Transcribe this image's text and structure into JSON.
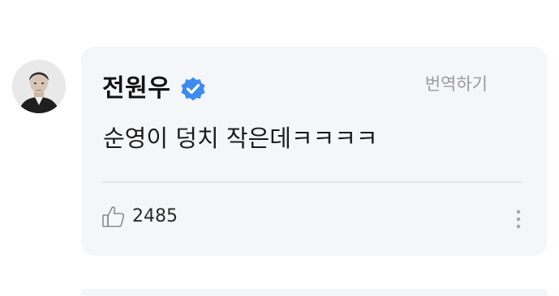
{
  "comment": {
    "author": "전원우",
    "verified": true,
    "translate_label": "번역하기",
    "text": "순영이 덩치 작은데ㅋㅋㅋㅋ",
    "like_count": "2485"
  },
  "icons": {
    "verified": "verified-badge-icon",
    "like": "thumbs-up-icon",
    "more": "more-vertical-icon"
  },
  "colors": {
    "card_background": "#f5f6f8",
    "verified_blue": "#3d8bf2",
    "muted_text": "#9a9a9a"
  }
}
